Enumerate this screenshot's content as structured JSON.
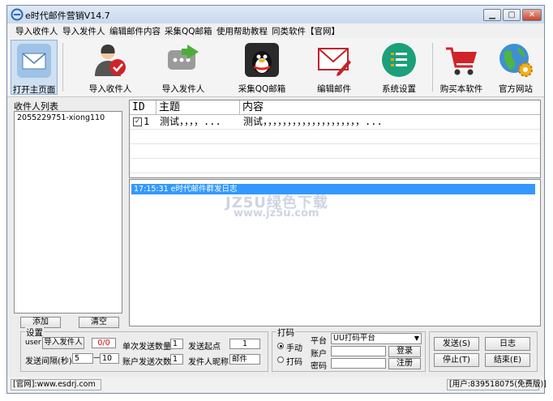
{
  "window": {
    "title": "e时代邮件营销V14.7"
  },
  "menu": [
    "导入收件人",
    "导入发件人",
    "编辑邮件内容",
    "采集QQ邮箱",
    "使用帮助教程",
    "同类软件【官网】"
  ],
  "toolbar": {
    "items": [
      {
        "label": "打开主页面",
        "icon": "envelope-icon"
      },
      {
        "label": "导入收件人",
        "icon": "user-check-icon"
      },
      {
        "label": "导入发件人",
        "icon": "message-arrow-icon"
      },
      {
        "label": "采集QQ邮箱",
        "icon": "qq-penguin-icon"
      },
      {
        "label": "编辑邮件",
        "icon": "mail-edit-icon"
      },
      {
        "label": "系统设置",
        "icon": "list-settings-icon"
      },
      {
        "label": "购买本软件",
        "icon": "cart-icon"
      },
      {
        "label": "官方网站",
        "icon": "globe-icon"
      }
    ]
  },
  "recipients": {
    "title": "收件人列表",
    "items": [
      "2055229751-xiong110"
    ],
    "add_label": "添加",
    "clear_label": "清空"
  },
  "grid": {
    "columns": [
      "ID",
      "主题",
      "内容"
    ],
    "rows": [
      {
        "checked": true,
        "id": "1",
        "subject": "测试，，，，...",
        "content": "测试，，，，，，，，，，，，，，，，，，，，..."
      }
    ]
  },
  "log": {
    "lines": [
      "17:15:31 e时代邮件群发日志"
    ],
    "watermark": "JZ5U绿色下载",
    "watermark_url": "www.jz5u.com"
  },
  "settings": {
    "group_label": "设置",
    "user_label": "user",
    "import_sender_button": "导入发件人",
    "sender_count": "0/0",
    "send_interval_label": "发送间隔(秒)",
    "interval_from": "5",
    "interval_to": "10",
    "per_send_label": "单次发送数量",
    "per_send_value": "1",
    "account_send_label": "账户发送次数",
    "account_send_value": "1",
    "start_point_label": "发送起点",
    "start_point_value": "1",
    "nickname_label": "发件人昵称",
    "nickname_value": "邮件"
  },
  "captcha": {
    "group_label": "打码",
    "manual_label": "手动",
    "auto_label": "打码",
    "platform_label": "平台",
    "platform_value": "UU打码平台",
    "account_label": "账户",
    "password_label": "密码",
    "login_label": "登录",
    "register_label": "注册"
  },
  "actions": {
    "send_label": "发送(S)",
    "log_label": "日志",
    "stop_label": "停止(T)",
    "end_label": "结束(E)"
  },
  "status": {
    "website": "[官网]:www.esdrj.com",
    "user": "[用户:839518075(免费版)]"
  },
  "colors": {
    "selection": "#3399ff",
    "active_tool": "#cfe0f2",
    "count_red": "#d40000"
  }
}
